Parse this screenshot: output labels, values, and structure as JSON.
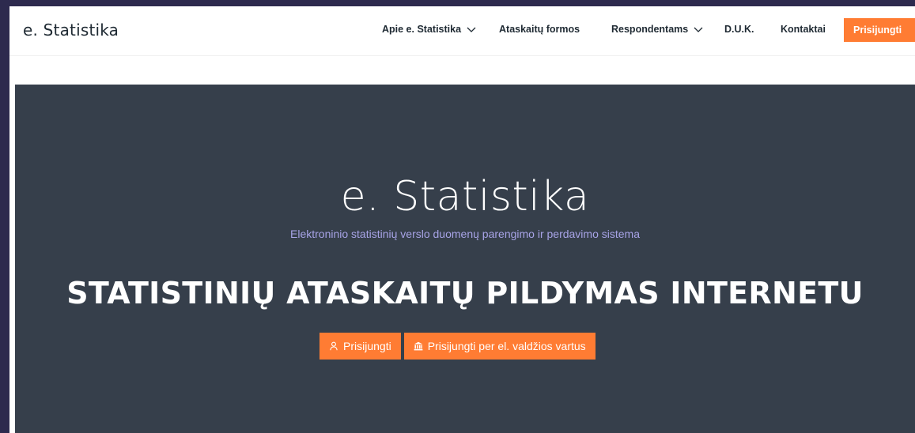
{
  "brand": {
    "logo_prefix": "e",
    "logo_dot": ".",
    "logo_suffix": " Statistika"
  },
  "nav": {
    "items": [
      {
        "label": "Apie e. Statistika",
        "has_dropdown": true
      },
      {
        "label": "Ataskaitų formos",
        "has_dropdown": false
      },
      {
        "label": "Respondentams",
        "has_dropdown": true
      },
      {
        "label": "D.U.K.",
        "has_dropdown": false
      },
      {
        "label": "Kontaktai",
        "has_dropdown": false
      }
    ],
    "login_label": "Prisijungti"
  },
  "hero": {
    "title": "e. Statistika",
    "subtitle": "Elektroninio statistinių verslo duomenų parengimo ir perdavimo sistema",
    "headline": "STATISTINIŲ ATASKAITŲ PILDYMAS INTERNETU",
    "login_button": "Prisijungti",
    "gov_login_button": "Prisijungti per el. valdžios vartus",
    "login_button_icon": "user-icon",
    "gov_login_button_icon": "bank-icon"
  },
  "colors": {
    "accent": "#ff7c33",
    "hero_background": "#363f4b",
    "subtitle": "#a7a3e6",
    "outer_background": "#2d2a4e"
  }
}
